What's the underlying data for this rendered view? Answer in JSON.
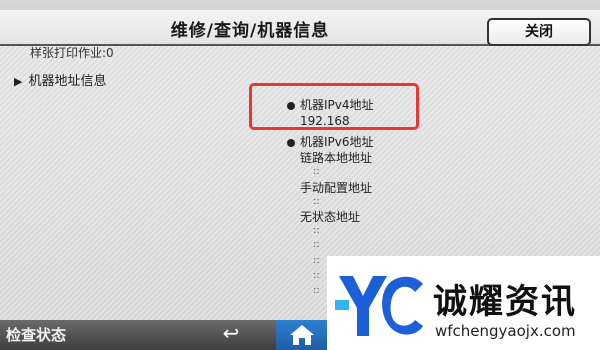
{
  "header": {
    "title": "维修/查询/机器信息",
    "close_label": "关闭"
  },
  "content": {
    "sample_job": "样张打印作业:0",
    "tree_item": "机器地址信息",
    "ipv4": {
      "label": "机器IPv4地址",
      "value": "192.168"
    },
    "ipv6": {
      "label": "机器IPv6地址",
      "link_local_label": "链路本地地址",
      "manual_label": "手动配置地址",
      "stateless_label": "无状态地址",
      "ellipsis": "::"
    }
  },
  "footer": {
    "status_label": "检查状态",
    "back_icon": "back-arrow-icon",
    "home_icon": "home-icon"
  },
  "watermark": {
    "brand": "诚耀资讯",
    "url": "wfchengyaojx.com"
  },
  "colors": {
    "highlight": "#e53935",
    "home_button": "#2f7fd0"
  }
}
